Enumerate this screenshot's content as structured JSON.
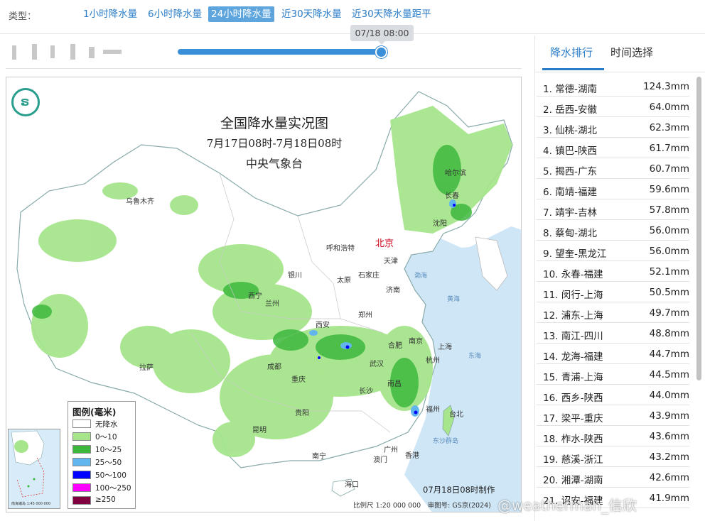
{
  "filter": {
    "label": "类型：",
    "tabs": [
      {
        "label": "1小时降水量",
        "active": false
      },
      {
        "label": "6小时降水量",
        "active": false
      },
      {
        "label": "24小时降水量",
        "active": true
      },
      {
        "label": "近30天降水量",
        "active": false
      },
      {
        "label": "近30天降水量距平",
        "active": false
      }
    ]
  },
  "timeline": {
    "current_time": "07/18 08:00",
    "progress": 1.0
  },
  "map": {
    "title": "全国降水量实况图",
    "period": "7月17日08时-7月18日08时",
    "agency": "中央气象台",
    "legend_title": "图例(毫米)",
    "legend": [
      {
        "label": "无降水",
        "color": "#ffffff"
      },
      {
        "label": "0～10",
        "color": "#a6e58c"
      },
      {
        "label": "10～25",
        "color": "#3db83d"
      },
      {
        "label": "25～50",
        "color": "#62b6f0"
      },
      {
        "label": "50～100",
        "color": "#0000ff"
      },
      {
        "label": "100～250",
        "color": "#ff00ff"
      },
      {
        "label": "≥250",
        "color": "#800040"
      }
    ],
    "cities": {
      "wulumuqi": "乌鲁木齐",
      "haerbin": "哈尔滨",
      "changchun": "长春",
      "shenyang": "沈阳",
      "beijing": "北京",
      "tianjin": "天津",
      "huhehaote": "呼和浩特",
      "yinchuan": "银川",
      "taiyuan": "太原",
      "shijiazhuang": "石家庄",
      "jinan": "济南",
      "xining": "西宁",
      "lanzhou": "兰州",
      "xian": "西安",
      "zhengzhou": "郑州",
      "hefei": "合肥",
      "nanjing": "南京",
      "shanghai": "上海",
      "wuhan": "武汉",
      "hangzhou": "杭州",
      "chengdu": "成都",
      "chongqing": "重庆",
      "changsha": "长沙",
      "nanchang": "南昌",
      "fuzhou": "福州",
      "lasa": "拉萨",
      "guiyang": "贵阳",
      "kunming": "昆明",
      "guangzhou": "广州",
      "nanning": "南宁",
      "xianggang": "香港",
      "aomen": "澳门",
      "taibei": "台北",
      "haikou": "海口"
    },
    "seas": {
      "bohai": "渤海",
      "huanghai": "黄海",
      "donghai": "东海",
      "dongshaqundao": "东沙群岛"
    },
    "inset_label": "南海诸岛 1:45 000 000",
    "made_note": "07月18日08时制作",
    "scale_note": "比例尺 1:20 000 000　审图号: GS京(2024)"
  },
  "panel": {
    "tabs": [
      {
        "label": "降水排行",
        "active": true
      },
      {
        "label": "时间选择",
        "active": false
      }
    ],
    "ranking": [
      {
        "name": "1. 常德-湖南",
        "value": "124.3mm"
      },
      {
        "name": "2. 岳西-安徽",
        "value": "64.0mm"
      },
      {
        "name": "3. 仙桃-湖北",
        "value": "62.3mm"
      },
      {
        "name": "4. 镇巴-陕西",
        "value": "61.7mm"
      },
      {
        "name": "5. 揭西-广东",
        "value": "60.7mm"
      },
      {
        "name": "6. 南靖-福建",
        "value": "59.6mm"
      },
      {
        "name": "7. 靖宇-吉林",
        "value": "57.8mm"
      },
      {
        "name": "8. 蔡甸-湖北",
        "value": "56.0mm"
      },
      {
        "name": "9. 望奎-黑龙江",
        "value": "56.0mm"
      },
      {
        "name": "10. 永春-福建",
        "value": "52.1mm"
      },
      {
        "name": "11. 闵行-上海",
        "value": "50.5mm"
      },
      {
        "name": "12. 浦东-上海",
        "value": "49.7mm"
      },
      {
        "name": "13. 南江-四川",
        "value": "48.8mm"
      },
      {
        "name": "14. 龙海-福建",
        "value": "44.7mm"
      },
      {
        "name": "15. 青浦-上海",
        "value": "44.5mm"
      },
      {
        "name": "16. 西乡-陕西",
        "value": "44.0mm"
      },
      {
        "name": "17. 梁平-重庆",
        "value": "43.9mm"
      },
      {
        "name": "18. 柞水-陕西",
        "value": "43.6mm"
      },
      {
        "name": "19. 慈溪-浙江",
        "value": "43.2mm"
      },
      {
        "name": "20. 湘潭-湖南",
        "value": "42.6mm"
      },
      {
        "name": "21. 诏安-福建",
        "value": "41.9mm"
      }
    ]
  },
  "watermark": "@weatherman_信欣"
}
